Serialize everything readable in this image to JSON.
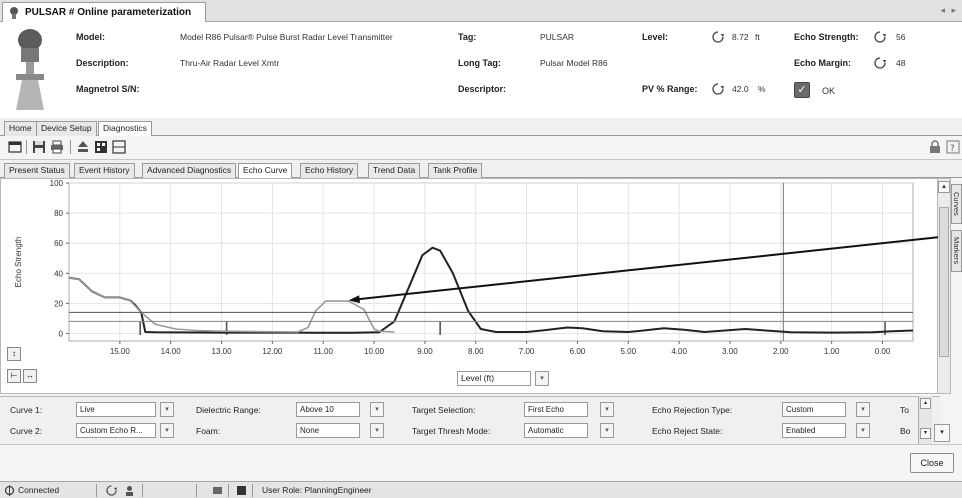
{
  "doc_tab": {
    "title": "PULSAR # Online parameterization",
    "nav": "◂ ▸"
  },
  "device": {
    "model_label": "Model:",
    "model_value": "Model R86 Pulsar® Pulse Burst Radar Level Transmitter",
    "description_label": "Description:",
    "description_value": "Thru-Air Radar Level Xmtr",
    "serial_label": "Magnetrol S/N:",
    "tag_label": "Tag:",
    "tag_value": "PULSAR",
    "long_tag_label": "Long Tag:",
    "long_tag_value": "Pulsar Model R86",
    "descriptor_label": "Descriptor:",
    "level_label": "Level:",
    "level_value": "8.72",
    "level_unit": "ft",
    "pv_range_label": "PV % Range:",
    "pv_range_value": "42.0",
    "pv_range_unit": "%",
    "echo_strength_label": "Echo Strength:",
    "echo_strength_value": "56",
    "echo_margin_label": "Echo Margin:",
    "echo_margin_value": "48",
    "status_text": "OK"
  },
  "main_tabs": [
    "Home",
    "Device Setup",
    "Diagnostics"
  ],
  "sub_tabs": [
    "Present Status",
    "Event History",
    "Advanced Diagnostics",
    "Echo Curve",
    "Echo History",
    "Trend Data",
    "Tank Profile"
  ],
  "side_tabs": {
    "curves": "Curves",
    "markers": "Markers"
  },
  "chart_data": {
    "type": "line",
    "ylabel": "Echo Strength",
    "xlim": [
      16.0,
      -0.6
    ],
    "ylim": [
      -5,
      100
    ],
    "x_ticks": [
      "15.00",
      "14.00",
      "13.00",
      "12.00",
      "11.00",
      "10.00",
      "9.00",
      "8.00",
      "7.00",
      "6.00",
      "5.00",
      "4.00",
      "3.00",
      "2.00",
      "1.00",
      "0.00"
    ],
    "x_tick_values": [
      15,
      14,
      13,
      12,
      11,
      10,
      9,
      8,
      7,
      6,
      5,
      4,
      3,
      2,
      1,
      0
    ],
    "y_ticks": [
      "0",
      "20",
      "40",
      "60",
      "80",
      "100"
    ],
    "y_tick_values": [
      0,
      20,
      40,
      60,
      80,
      100
    ],
    "grid": true,
    "series": [
      {
        "role": "echo-curve",
        "color": "#222222",
        "points": [
          [
            16.0,
            37
          ],
          [
            15.8,
            36
          ],
          [
            15.55,
            28
          ],
          [
            15.3,
            24
          ],
          [
            15.0,
            24
          ],
          [
            14.8,
            22
          ],
          [
            14.7,
            19
          ],
          [
            14.58,
            14
          ],
          [
            14.5,
            1
          ],
          [
            14.3,
            0.8
          ],
          [
            13.0,
            0.6
          ],
          [
            11.5,
            0.6
          ],
          [
            11.3,
            0.5
          ],
          [
            10.4,
            0.5
          ],
          [
            9.9,
            0.8
          ],
          [
            9.6,
            8
          ],
          [
            9.3,
            32
          ],
          [
            9.05,
            52
          ],
          [
            8.85,
            57
          ],
          [
            8.7,
            55
          ],
          [
            8.45,
            40
          ],
          [
            8.15,
            15
          ],
          [
            7.9,
            3
          ],
          [
            7.6,
            1
          ],
          [
            7.0,
            1
          ],
          [
            6.7,
            2
          ],
          [
            6.2,
            4
          ],
          [
            5.9,
            3.5
          ],
          [
            5.5,
            1.5
          ],
          [
            5.0,
            1
          ],
          [
            4.7,
            2
          ],
          [
            4.3,
            3.5
          ],
          [
            3.9,
            2.5
          ],
          [
            3.5,
            1
          ],
          [
            3.1,
            2
          ],
          [
            2.7,
            3
          ],
          [
            2.3,
            2
          ],
          [
            1.8,
            0.8
          ],
          [
            1.0,
            0.6
          ],
          [
            0.2,
            0.8
          ],
          [
            -0.2,
            1.5
          ],
          [
            -0.6,
            2
          ]
        ]
      },
      {
        "role": "reference-curve",
        "color": "#999999",
        "points": [
          [
            16.0,
            37
          ],
          [
            15.8,
            36
          ],
          [
            15.55,
            28
          ],
          [
            15.3,
            24
          ],
          [
            15.0,
            24
          ],
          [
            14.8,
            22
          ],
          [
            14.58,
            14
          ],
          [
            14.3,
            6
          ],
          [
            13.9,
            3
          ],
          [
            13.5,
            2
          ],
          [
            13.0,
            1.5
          ],
          [
            11.5,
            1
          ],
          [
            11.3,
            4
          ],
          [
            11.15,
            15
          ],
          [
            10.95,
            21.5
          ],
          [
            10.5,
            21.5
          ],
          [
            10.2,
            16
          ],
          [
            10.0,
            3
          ],
          [
            9.9,
            1.5
          ],
          [
            9.6,
            1
          ]
        ]
      },
      {
        "role": "threshold-line",
        "color": "#555555",
        "points": [
          [
            16.0,
            14
          ],
          [
            -0.6,
            14
          ]
        ]
      },
      {
        "role": "threshold-line-2",
        "color": "#888888",
        "points": [
          [
            16.0,
            8
          ],
          [
            -0.6,
            8
          ]
        ]
      }
    ],
    "vertical_markers": [
      14.6,
      12.9,
      8.7,
      1.95,
      -0.05
    ],
    "annotation_arrow": {
      "from": [
        -0.6,
        64
      ],
      "to": [
        10.5,
        22
      ]
    }
  },
  "unit_select": {
    "value": "Level (ft)"
  },
  "bottom": {
    "curve1_label": "Curve 1:",
    "curve1_value": "Live",
    "curve2_label": "Curve 2:",
    "curve2_value": "Custom Echo R...",
    "dielectric_label": "Dielectric Range:",
    "dielectric_value": "Above 10",
    "foam_label": "Foam:",
    "foam_value": "None",
    "target_selection_label": "Target Selection:",
    "target_selection_value": "First Echo",
    "target_thresh_label": "Target Thresh Mode:",
    "target_thresh_value": "Automatic",
    "echo_rejection_label": "Echo Rejection Type:",
    "echo_rejection_value": "Custom",
    "echo_reject_state_label": "Echo Reject State:",
    "echo_reject_state_value": "Enabled",
    "trunc1": "To",
    "trunc2": "Bo"
  },
  "close_label": "Close",
  "status": {
    "connected": "Connected",
    "role": "User Role: PlanningEngineer"
  }
}
